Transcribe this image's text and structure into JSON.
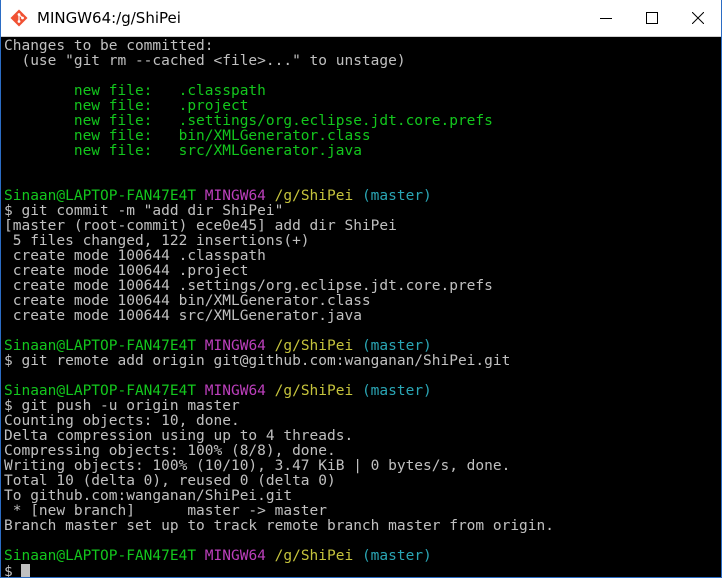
{
  "window": {
    "title": "MINGW64:/g/ShiPei",
    "icon": "git-bash-icon",
    "controls": {
      "minimize": "minimize-icon",
      "maximize": "maximize-icon",
      "close": "close-icon"
    }
  },
  "colors": {
    "green": "#13c71d",
    "magenta": "#bc3fbc",
    "yellow": "#c5c33c",
    "cyan": "#2aa6b5",
    "text": "#c0c0c0",
    "background": "#000000"
  },
  "terminal": {
    "status_header": "Changes to be committed:",
    "status_hint": "  (use \"git rm --cached <file>...\" to unstage)",
    "staged_files": [
      "        new file:   .classpath",
      "        new file:   .project",
      "        new file:   .settings/org.eclipse.jdt.core.prefs",
      "        new file:   bin/XMLGenerator.class",
      "        new file:   src/XMLGenerator.java"
    ],
    "prompt": {
      "user": "Sinaan@LAPTOP-FAN47E4T",
      "env": "MINGW64",
      "path": "/g/ShiPei",
      "branch": "(master)"
    },
    "cmd_commit": "$ git commit -m \"add dir ShiPei\"",
    "commit_output": [
      "[master (root-commit) ece0e45] add dir ShiPei",
      " 5 files changed, 122 insertions(+)",
      " create mode 100644 .classpath",
      " create mode 100644 .project",
      " create mode 100644 .settings/org.eclipse.jdt.core.prefs",
      " create mode 100644 bin/XMLGenerator.class",
      " create mode 100644 src/XMLGenerator.java"
    ],
    "cmd_remote": "$ git remote add origin git@github.com:wanganan/ShiPei.git",
    "cmd_push": "$ git push -u origin master",
    "push_output": [
      "Counting objects: 10, done.",
      "Delta compression using up to 4 threads.",
      "Compressing objects: 100% (8/8), done.",
      "Writing objects: 100% (10/10), 3.47 KiB | 0 bytes/s, done.",
      "Total 10 (delta 0), reused 0 (delta 0)",
      "To github.com:wanganan/ShiPei.git",
      " * [new branch]      master -> master",
      "Branch master set up to track remote branch master from origin."
    ],
    "final_prompt_symbol": "$"
  }
}
